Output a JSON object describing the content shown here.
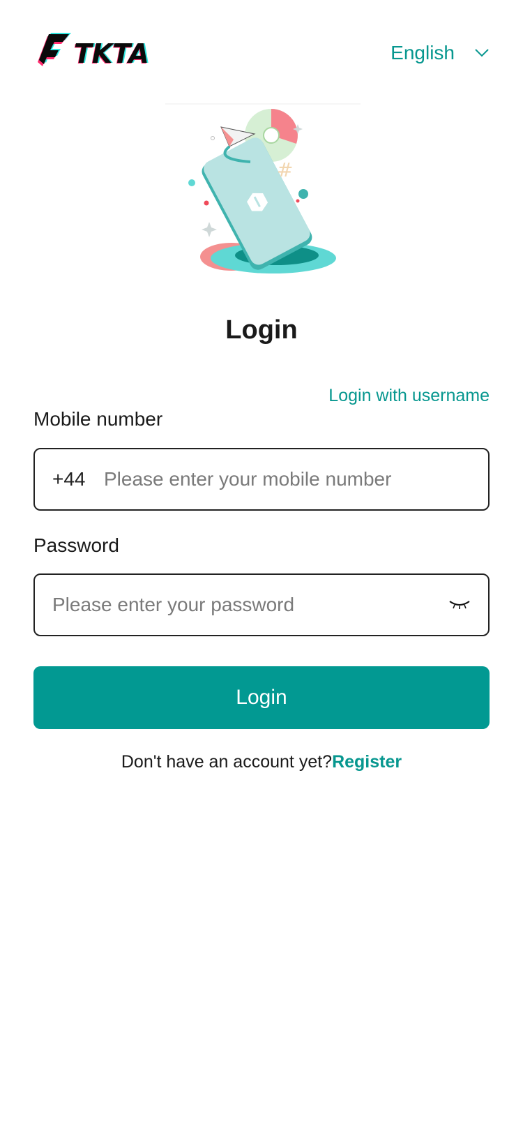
{
  "header": {
    "logo_text": "TKTA",
    "language": {
      "selected": "English",
      "icon": "chevron-down-icon"
    }
  },
  "hero": {
    "icon": "phone-illustration"
  },
  "form": {
    "title": "Login",
    "alt_login_label": "Login with username",
    "mobile": {
      "label": "Mobile number",
      "country_code": "+44",
      "placeholder": "Please enter your mobile number",
      "value": ""
    },
    "password": {
      "label": "Password",
      "placeholder": "Please enter your password",
      "value": "",
      "toggle_icon": "eye-closed-icon"
    },
    "submit_label": "Login"
  },
  "footer": {
    "prompt": "Don't have an account yet?",
    "register_label": "Register"
  },
  "colors": {
    "accent": "#029992",
    "accent_text": "#07978f",
    "text": "#1a1a1a",
    "placeholder": "#7a7a7a"
  }
}
